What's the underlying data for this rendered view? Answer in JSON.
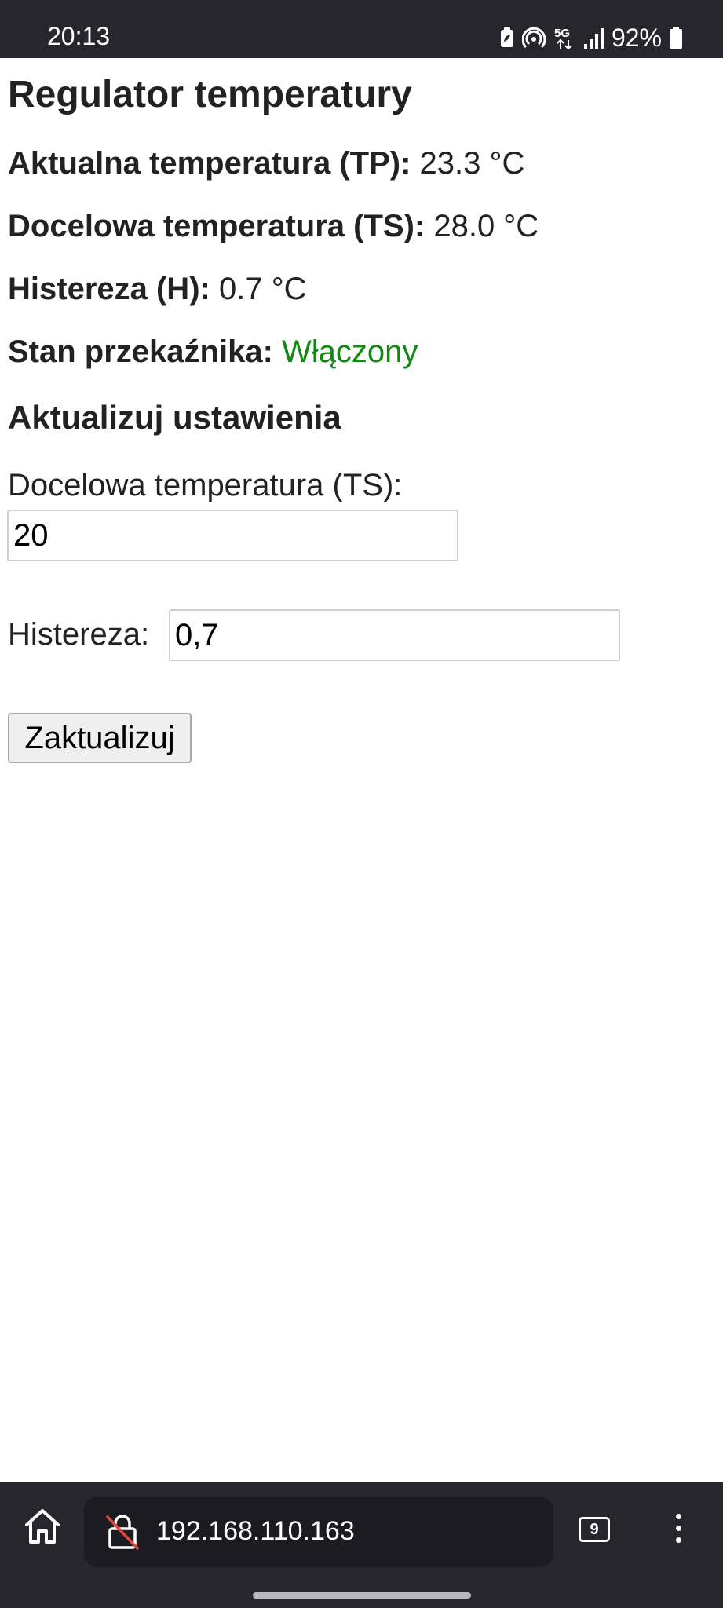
{
  "status_bar": {
    "time": "20:13",
    "battery_percent": "92%",
    "network_label": "5G",
    "icons": [
      "battery-saver-icon",
      "hotspot-icon",
      "5g-icon",
      "signal-icon",
      "battery-icon"
    ]
  },
  "page": {
    "title": "Regulator temperatury",
    "current_temp": {
      "label": "Aktualna temperatura (TP):",
      "value": "23.3 °C"
    },
    "target_temp": {
      "label": "Docelowa temperatura (TS):",
      "value": "28.0 °C"
    },
    "hysteresis": {
      "label": "Histereza (H):",
      "value": "0.7 °C"
    },
    "relay_state": {
      "label": "Stan przekaźnika:",
      "value": "Włączony",
      "color": "#118811"
    },
    "settings_heading": "Aktualizuj ustawienia",
    "form": {
      "target_label": "Docelowa temperatura (TS):",
      "target_value": "20",
      "hysteresis_label": "Histereza:",
      "hysteresis_value": "0,7",
      "submit_label": "Zaktualizuj"
    }
  },
  "browser": {
    "url": "192.168.110.163",
    "tab_count": "9",
    "icons": [
      "home-icon",
      "insecure-lock-icon",
      "tabs-icon",
      "more-vert-icon"
    ]
  }
}
